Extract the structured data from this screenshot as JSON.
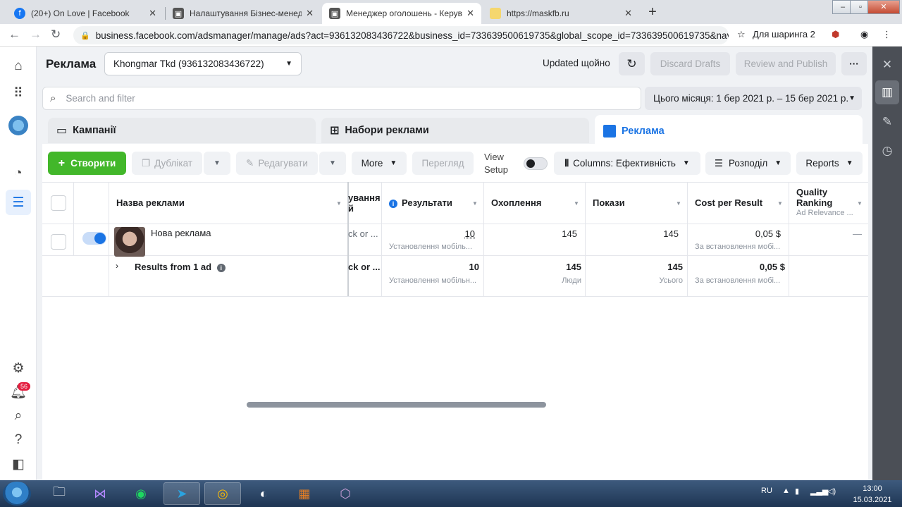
{
  "browser": {
    "tabs": [
      {
        "title": "(20+) On Love | Facebook",
        "icon": "facebook-icon"
      },
      {
        "title": "Налаштування Бізнес-менеджера",
        "icon": "page-icon"
      },
      {
        "title": "Менеджер оголошень - Керува",
        "icon": "page-icon"
      },
      {
        "title": "https://maskfb.ru",
        "icon": "page-icon"
      }
    ],
    "url": "business.facebook.com/adsmanager/manage/ads?act=936132083436722&business_id=733639500619735&global_scope_id=733639500619735&nav_ent...",
    "profile_label": "Для шаринга 2"
  },
  "header": {
    "title": "Реклама",
    "account": "Khongmar Tkd (936132083436722)",
    "updated": "Updated щойно",
    "discard": "Discard Drafts",
    "review": "Review and Publish",
    "more": "···"
  },
  "search": {
    "placeholder": "Search and filter"
  },
  "date_range": "Цього місяця: 1 бер 2021 р. – 15 бер 2021 р.",
  "level_tabs": [
    {
      "label": "Кампанії"
    },
    {
      "label": "Набори реклами"
    },
    {
      "label": "Реклама"
    }
  ],
  "toolbar": {
    "create": "Створити",
    "duplicate": "Дублікат",
    "edit": "Редагувати",
    "more": "More",
    "preview": "Перегляд",
    "view_setup_1": "View",
    "view_setup_2": "Setup",
    "columns": "Columns: Ефективність",
    "breakdown": "Розподіл",
    "reports": "Reports"
  },
  "table": {
    "headers": {
      "name": "Назва реклами",
      "partial_1": "ування",
      "partial_2": "й",
      "results": "Результати",
      "reach": "Охоплення",
      "impressions": "Покази",
      "cpr": "Cost per Result",
      "quality_1": "Quality",
      "quality_2": "Ranking",
      "quality_sub": "Ad Relevance ..."
    },
    "row": {
      "name": "Нова реклама",
      "partial": "ck or ...",
      "results": "10",
      "results_sub": "Установлення мобіль...",
      "reach": "145",
      "impressions": "145",
      "cpr": "0,05 $",
      "cpr_sub": "За встановлення мобі...",
      "quality": "—"
    },
    "summary": {
      "label": "Results from 1 ad",
      "partial": "ck or ...",
      "results": "10",
      "results_sub": "Установлення мобільн...",
      "reach": "145",
      "reach_sub": "Люди",
      "impressions": "145",
      "impressions_sub": "Усього",
      "cpr": "0,05 $",
      "cpr_sub": "За встановлення мобі..."
    }
  },
  "rail": {
    "notification_count": "56"
  },
  "taskbar": {
    "lang": "RU",
    "time": "13:00",
    "date": "15.03.2021"
  }
}
